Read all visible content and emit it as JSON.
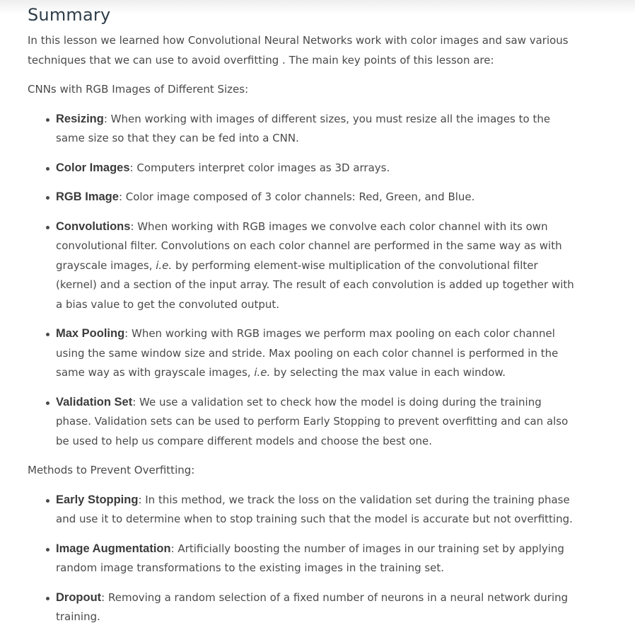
{
  "title": "Summary",
  "intro": "In this lesson we learned how Convolutional Neural Networks work with color images and saw various techniques that we can use to avoid overfitting . The main key points of this lesson are:",
  "section1": {
    "heading": "CNNs with RGB Images of Different Sizes:",
    "items": [
      {
        "term": "Resizing",
        "text": ": When working with images of different sizes, you must resize all the images to the same size so that they can be fed into a CNN."
      },
      {
        "term": "Color Images",
        "text": ": Computers interpret color images as 3D arrays."
      },
      {
        "term": "RGB Image",
        "text": ": Color image composed of 3 color channels: Red, Green, and Blue."
      },
      {
        "term": "Convolutions",
        "text_a": ": When working with RGB images we convolve each color channel with its own convolutional filter. Convolutions on each color channel are performed in the same way as with grayscale images, ",
        "ie": "i.e.",
        "text_b": " by performing element-wise multiplication of the convolutional filter (kernel) and a section of the input array. The result of each convolution is added up together with a bias value to get the convoluted output."
      },
      {
        "term": "Max Pooling",
        "text_a": ": When working with RGB images we perform max pooling on each color channel using the same window size and stride. Max pooling on each color channel is performed in the same way as with grayscale images, ",
        "ie": "i.e.",
        "text_b": " by selecting the max value in each window."
      },
      {
        "term": "Validation Set",
        "text": ": We use a validation set to check how the model is doing during the training phase. Validation sets can be used to perform Early Stopping to prevent overfitting and can also be used to help us compare different models and choose the best one."
      }
    ]
  },
  "section2": {
    "heading": "Methods to Prevent Overfitting:",
    "items": [
      {
        "term": "Early Stopping",
        "text": ": In this method, we track the loss on the validation set during the training phase and use it to determine when to stop training such that the model is accurate but not overfitting."
      },
      {
        "term": "Image Augmentation",
        "text": ": Artificially boosting the number of images in our training set by applying random image transformations to the existing images in the training set."
      },
      {
        "term": "Dropout",
        "text": ": Removing a random selection of a fixed number of neurons in a neural network during training."
      }
    ]
  }
}
